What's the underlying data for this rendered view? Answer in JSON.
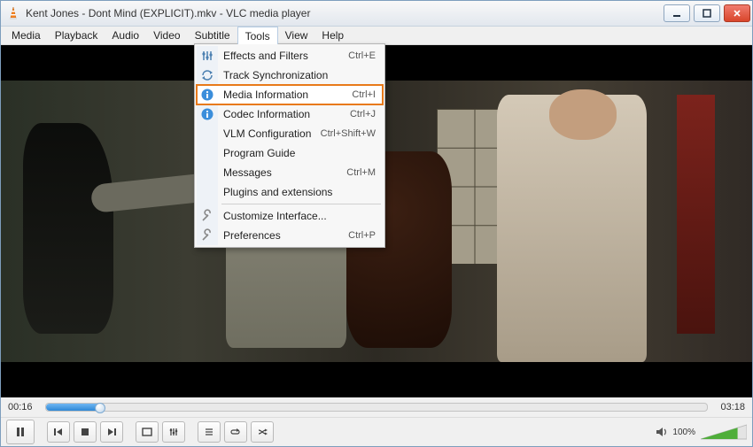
{
  "window": {
    "title": "Kent Jones - Dont Mind (EXPLICIT).mkv - VLC media player"
  },
  "menubar": [
    {
      "id": "media",
      "label": "Media"
    },
    {
      "id": "playback",
      "label": "Playback"
    },
    {
      "id": "audio",
      "label": "Audio"
    },
    {
      "id": "video",
      "label": "Video"
    },
    {
      "id": "subtitle",
      "label": "Subtitle"
    },
    {
      "id": "tools",
      "label": "Tools",
      "active": true
    },
    {
      "id": "view",
      "label": "View"
    },
    {
      "id": "help",
      "label": "Help"
    }
  ],
  "tools_menu": {
    "items": [
      {
        "icon": "equalizer",
        "label": "Effects and Filters",
        "shortcut": "Ctrl+E"
      },
      {
        "icon": "sync",
        "label": "Track Synchronization",
        "shortcut": ""
      },
      {
        "icon": "info",
        "label": "Media Information",
        "shortcut": "Ctrl+I",
        "highlighted": true
      },
      {
        "icon": "info",
        "label": "Codec Information",
        "shortcut": "Ctrl+J"
      },
      {
        "icon": "",
        "label": "VLM Configuration",
        "shortcut": "Ctrl+Shift+W"
      },
      {
        "icon": "",
        "label": "Program Guide",
        "shortcut": ""
      },
      {
        "icon": "",
        "label": "Messages",
        "shortcut": "Ctrl+M"
      },
      {
        "icon": "",
        "label": "Plugins and extensions",
        "shortcut": ""
      },
      {
        "sep": true
      },
      {
        "icon": "wrench",
        "label": "Customize Interface...",
        "shortcut": ""
      },
      {
        "icon": "wrench",
        "label": "Preferences",
        "shortcut": "Ctrl+P"
      }
    ]
  },
  "playback": {
    "current_time": "00:16",
    "total_time": "03:18",
    "progress_pct": 8
  },
  "volume": {
    "pct_label": "100%",
    "pct": 100
  }
}
